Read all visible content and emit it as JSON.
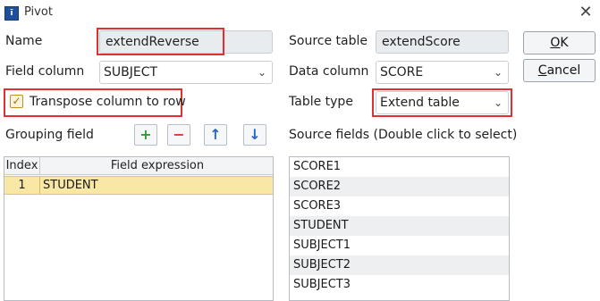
{
  "window": {
    "title": "Pivot",
    "icon": "app-icon"
  },
  "form": {
    "name_label": "Name",
    "name_value": "extendReverse",
    "source_table_label": "Source table",
    "source_table_value": "extendScore",
    "field_column_label": "Field column",
    "field_column_value": "SUBJECT",
    "data_column_label": "Data column",
    "data_column_value": "SCORE",
    "transpose_label": "Transpose column to row",
    "transpose_checked": true,
    "table_type_label": "Table type",
    "table_type_value": "Extend table",
    "grouping_label": "Grouping field",
    "source_fields_label": "Source fields (Double click to select)"
  },
  "buttons": {
    "ok": "OK",
    "ok_mnemonic": "O",
    "ok_rest": "K",
    "cancel": "Cancel",
    "cancel_mnemonic": "C",
    "cancel_rest": "ancel"
  },
  "toolbar": {
    "add": "add-icon",
    "remove": "remove-icon",
    "up": "arrow-up-icon",
    "down": "arrow-down-icon"
  },
  "grouping_table": {
    "columns": [
      "Index",
      "Field expression"
    ],
    "rows": [
      {
        "index": "1",
        "expression": "STUDENT"
      }
    ]
  },
  "source_fields": [
    "SCORE1",
    "SCORE2",
    "SCORE3",
    "STUDENT",
    "SUBJECT1",
    "SUBJECT2",
    "SUBJECT3"
  ],
  "colors": {
    "highlight": "#e03030",
    "selected_row": "#f9e7a6",
    "add_icon": "#2e9e2e",
    "remove_icon": "#d63a3a",
    "arrow_icon": "#2a62c9"
  }
}
